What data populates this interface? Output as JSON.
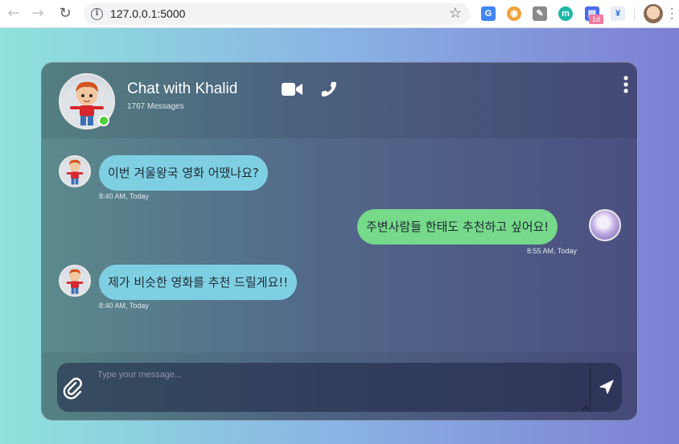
{
  "browser": {
    "url": "127.0.0.1:5000",
    "extensions": [
      {
        "name": "google-translate-icon",
        "color": "#4285f4",
        "glyph": "G"
      },
      {
        "name": "glasses-extension-icon",
        "color": "#f2a23c",
        "glyph": "◉"
      },
      {
        "name": "pen-extension-icon",
        "color": "#7d7d7d",
        "glyph": "✎"
      },
      {
        "name": "m-extension-icon",
        "color": "#1fb8a6",
        "glyph": "m"
      },
      {
        "name": "calendar-extension-icon",
        "color": "#4a6cf0",
        "glyph": "▤",
        "badge": "1d"
      },
      {
        "name": "doc-extension-icon",
        "color": "#e8eef8",
        "glyph": "¥"
      }
    ]
  },
  "chat": {
    "title": "Chat with Khalid",
    "message_count": "1767 Messages",
    "online_color": "#4cd137",
    "messages": [
      {
        "direction": "incoming",
        "text": "이번 겨울왕국 영화 어땠나요?",
        "time": "8:40 AM, Today"
      },
      {
        "direction": "outgoing",
        "text": "주변사람들 한태도 추천하고 싶어요!",
        "time": "8:55 AM, Today"
      },
      {
        "direction": "incoming",
        "text": "제가 비슷한 영화를 추천 드릴게요!!",
        "time": "8:40 AM, Today"
      }
    ],
    "input_placeholder": "Type your message...",
    "colors": {
      "incoming_bubble": "#7fcfe3",
      "outgoing_bubble": "#77d98a"
    }
  }
}
